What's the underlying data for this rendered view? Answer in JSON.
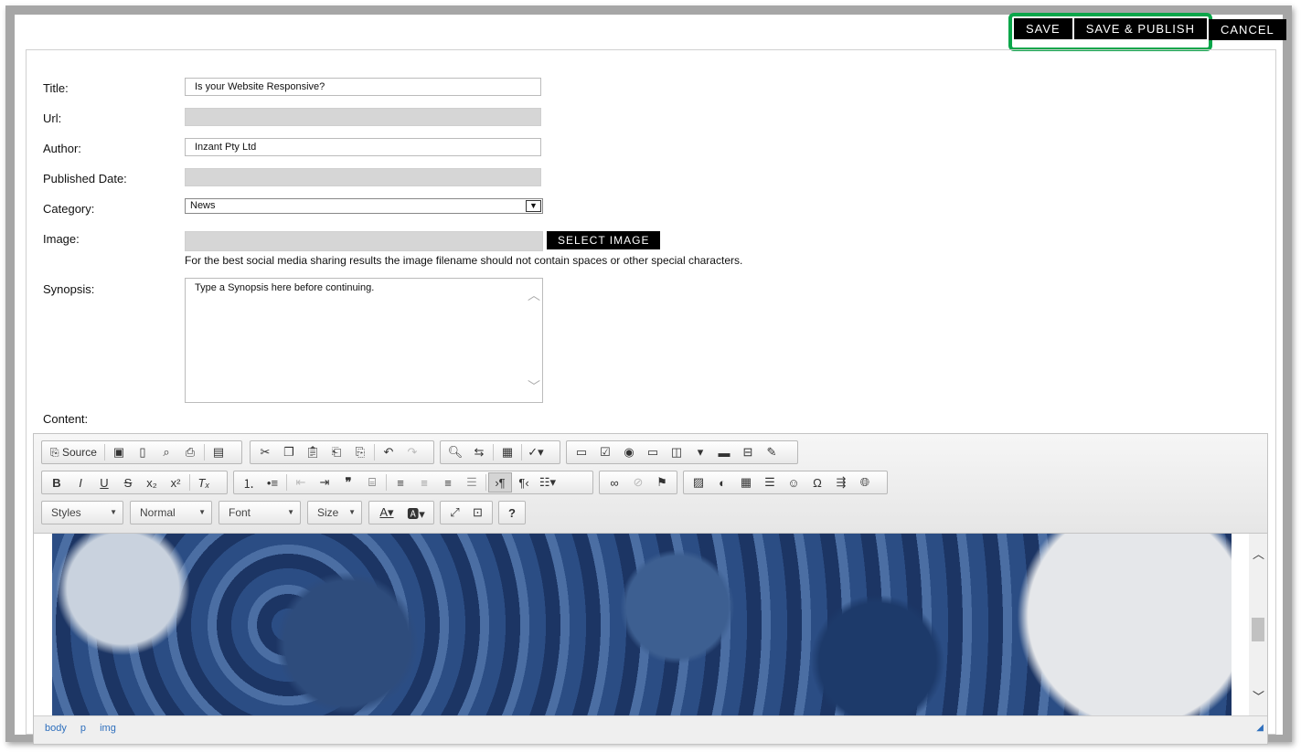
{
  "actions": {
    "save": "SAVE",
    "save_publish": "SAVE & PUBLISH",
    "cancel": "CANCEL"
  },
  "form": {
    "title_label": "Title:",
    "title_value": "Is your Website Responsive?",
    "url_label": "Url:",
    "url_value": "",
    "author_label": "Author:",
    "author_value": "Inzant Pty Ltd",
    "published_label": "Published Date:",
    "published_value": "",
    "category_label": "Category:",
    "category_value": "News",
    "image_label": "Image:",
    "image_value": "",
    "select_image": "SELECT IMAGE",
    "image_hint": "For the best social media sharing results the image filename should not contain spaces or other special characters.",
    "synopsis_label": "Synopsis:",
    "synopsis_value": "Type a Synopsis here before continuing.",
    "content_label": "Content:"
  },
  "editor": {
    "source_label": "Source",
    "combos": {
      "styles": "Styles",
      "format": "Normal",
      "font": "Font",
      "size": "Size"
    },
    "help": "?",
    "path": [
      "body",
      "p",
      "img"
    ]
  },
  "colors": {
    "highlight": "#0aa64a",
    "button": "#000000",
    "link": "#2e6fbd"
  }
}
